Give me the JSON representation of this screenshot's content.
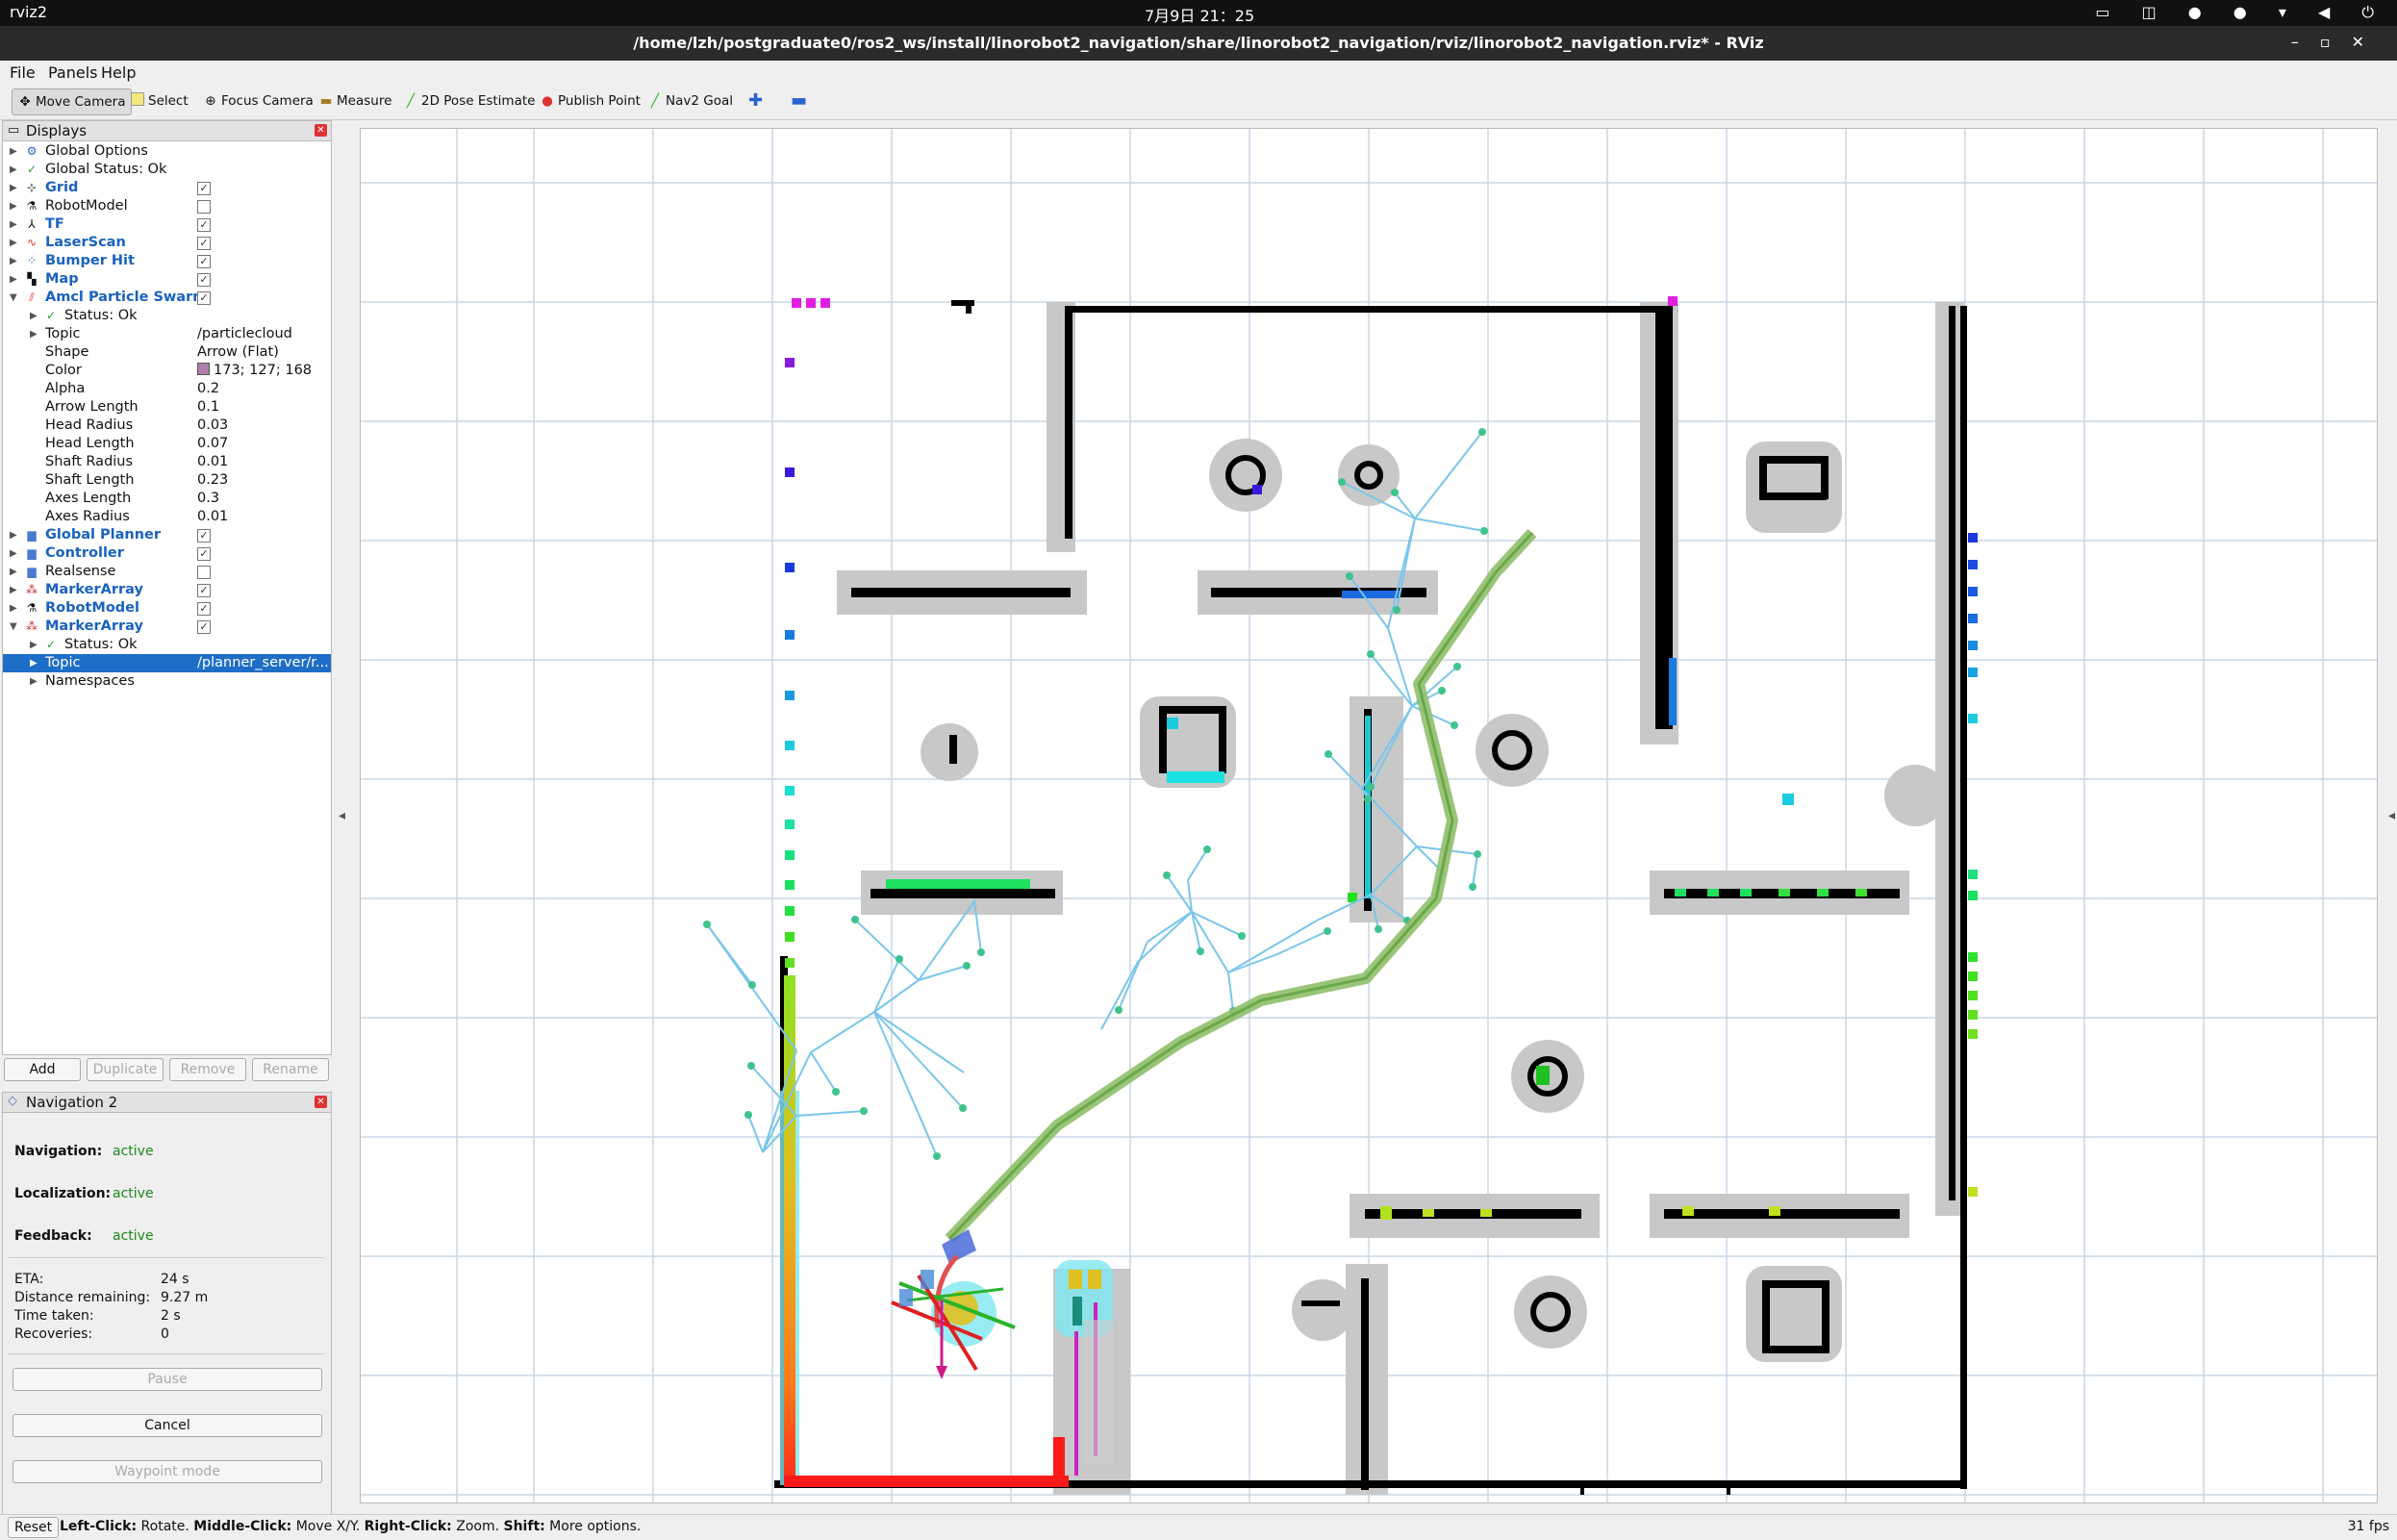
{
  "topbar": {
    "app": "rviz2",
    "clock": "7月9日 21：25"
  },
  "window": {
    "title": "/home/lzh/postgraduate0/ros2_ws/install/linorobot2_navigation/share/linorobot2_navigation/rviz/linorobot2_navigation.rviz* - RViz"
  },
  "menu": {
    "file": "File",
    "panels": "Panels",
    "help": "Help"
  },
  "toolbar": {
    "move_camera": "Move Camera",
    "select": "Select",
    "focus_camera": "Focus Camera",
    "measure": "Measure",
    "pose_estimate": "2D Pose Estimate",
    "publish_point": "Publish Point",
    "nav2_goal": "Nav2 Goal"
  },
  "displays": {
    "title": "Displays",
    "rows": {
      "global_options": "Global Options",
      "global_status": "Global Status: Ok",
      "grid": "Grid",
      "robot_model": "RobotModel",
      "tf": "TF",
      "laser_scan": "LaserScan",
      "bumper_hit": "Bumper Hit",
      "map": "Map",
      "amcl": "Amcl Particle Swarm",
      "amcl_status": "Status: Ok",
      "topic_label": "Topic",
      "topic_value": "/particlecloud",
      "shape_label": "Shape",
      "shape_value": "Arrow (Flat)",
      "color_label": "Color",
      "color_value": "173; 127; 168",
      "alpha_label": "Alpha",
      "alpha_value": "0.2",
      "arrow_length_label": "Arrow Length",
      "arrow_length_value": "0.1",
      "head_radius_label": "Head Radius",
      "head_radius_value": "0.03",
      "head_length_label": "Head Length",
      "head_length_value": "0.07",
      "shaft_radius_label": "Shaft Radius",
      "shaft_radius_value": "0.01",
      "shaft_length_label": "Shaft Length",
      "shaft_length_value": "0.23",
      "axes_length_label": "Axes Length",
      "axes_length_value": "0.3",
      "axes_radius_label": "Axes Radius",
      "axes_radius_value": "0.01",
      "global_planner": "Global Planner",
      "controller": "Controller",
      "realsense": "Realsense",
      "marker_array_1": "MarkerArray",
      "robot_model_2": "RobotModel",
      "marker_array_2": "MarkerArray",
      "marker_status": "Status: Ok",
      "marker_topic_label": "Topic",
      "marker_topic_value": "/planner_server/r...",
      "namespaces": "Namespaces"
    },
    "buttons": {
      "add": "Add",
      "duplicate": "Duplicate",
      "remove": "Remove",
      "rename": "Rename"
    }
  },
  "navigation": {
    "title": "Navigation 2",
    "navigation_label": "Navigation:",
    "navigation_value": "active",
    "localization_label": "Localization:",
    "localization_value": "active",
    "feedback_label": "Feedback:",
    "feedback_value": "active",
    "eta_label": "ETA:",
    "eta_value": "24 s",
    "distance_label": "Distance remaining:",
    "distance_value": "9.27 m",
    "time_label": "Time taken:",
    "time_value": "2 s",
    "recoveries_label": "Recoveries:",
    "recoveries_value": "0",
    "pause": "Pause",
    "cancel": "Cancel",
    "waypoint": "Waypoint mode"
  },
  "status": {
    "reset": "Reset",
    "hint_left": "Left-Click:",
    "hint_left_text": " Rotate. ",
    "hint_middle": "Middle-Click:",
    "hint_middle_text": " Move X/Y. ",
    "hint_right": "Right-Click:",
    "hint_right_text": " Zoom. ",
    "hint_shift": "Shift:",
    "hint_shift_text": " More options.",
    "fps": "31 fps"
  },
  "colors": {
    "accent": "#1e6ec8",
    "active_text": "#1a8a1a",
    "path": "#8fbf6a",
    "particle": "#ad7fa8"
  }
}
